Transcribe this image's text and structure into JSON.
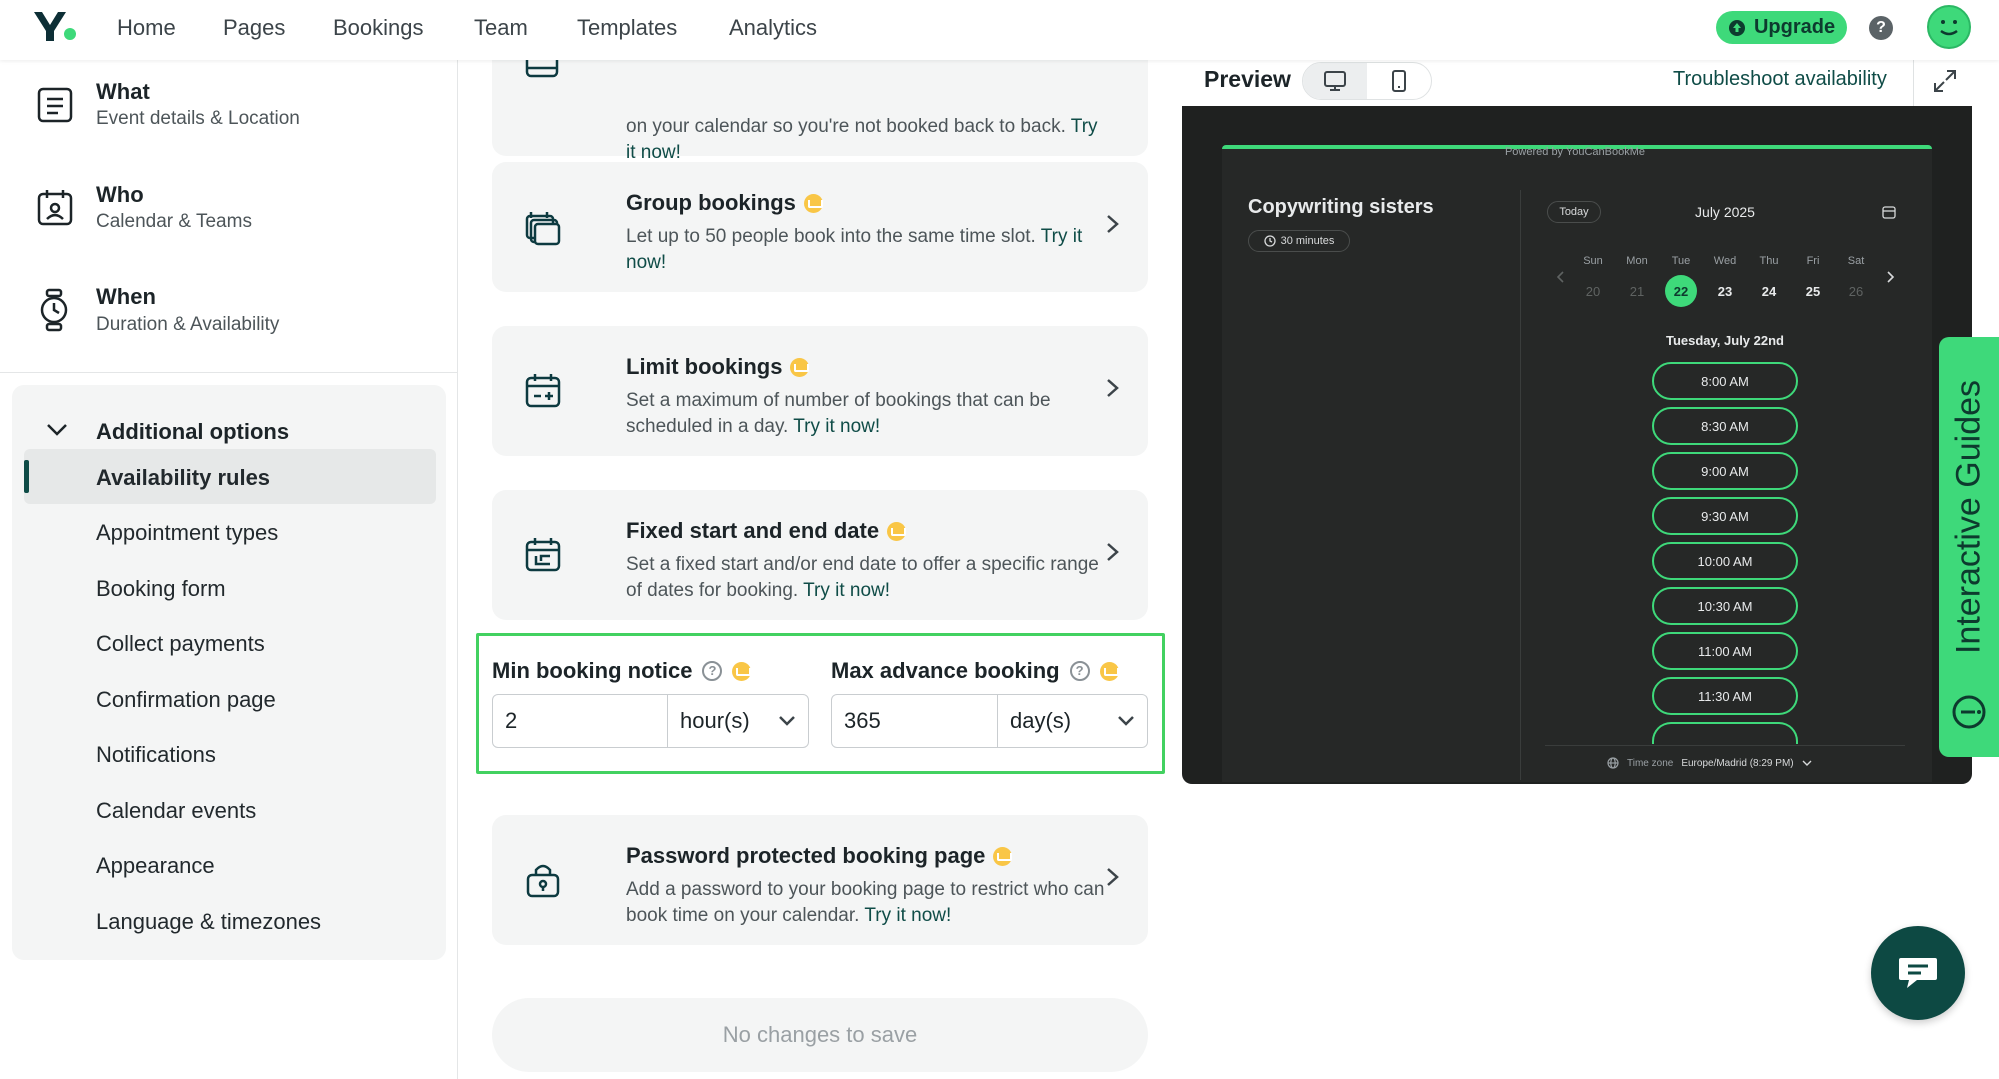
{
  "nav": {
    "links": [
      "Home",
      "Pages",
      "Bookings",
      "Team",
      "Templates",
      "Analytics"
    ],
    "upgrade_label": "Upgrade",
    "help_label": "?"
  },
  "sidebar": {
    "sections": [
      {
        "title": "What",
        "subtitle": "Event details & Location",
        "icon": "list-card-icon"
      },
      {
        "title": "Who",
        "subtitle": "Calendar & Teams",
        "icon": "calendar-person-icon"
      },
      {
        "title": "When",
        "subtitle": "Duration & Availability",
        "icon": "watch-icon"
      }
    ],
    "additional": {
      "title": "Additional options",
      "active_index": 0,
      "items": [
        "Availability rules",
        "Appointment types",
        "Booking form",
        "Collect payments",
        "Confirmation page",
        "Notifications",
        "Calendar events",
        "Appearance",
        "Language & timezones"
      ]
    }
  },
  "main": {
    "top_card": {
      "desc": "on your calendar so you're not booked back to back.",
      "link": "Try it now!"
    },
    "cards": [
      {
        "title": "Group bookings",
        "desc": "Let up to 50 people book into the same time slot.",
        "link": "Try it now!",
        "icon": "layers-icon"
      },
      {
        "title": "Limit bookings",
        "desc": "Set a maximum of number of bookings that can be scheduled in a day.",
        "link": "Try it now!",
        "icon": "calendar-plus-icon"
      },
      {
        "title": "Fixed start and end date",
        "desc": "Set a fixed start and/or end date to offer a specific range of dates for booking.",
        "link": "Try it now!",
        "icon": "calendar-range-icon"
      }
    ],
    "booking_fields": {
      "min": {
        "label": "Min booking notice",
        "value": "2",
        "unit": "hour(s)"
      },
      "max": {
        "label": "Max advance booking",
        "value": "365",
        "unit": "day(s)"
      }
    },
    "password_card": {
      "title": "Password protected booking page",
      "desc": "Add a password to your booking page to restrict who can book time on your calendar.",
      "link": "Try it now!",
      "icon": "lock-icon"
    },
    "save_label": "No changes to save"
  },
  "preview": {
    "title": "Preview",
    "troubleshoot": "Troubleshoot availability",
    "powered": "Powered by YouCanBookMe",
    "event_name": "Copywriting sisters",
    "duration": "30 minutes",
    "today": "Today",
    "month": "July 2025",
    "days": [
      {
        "name": "Sun",
        "num": "20",
        "state": "dim"
      },
      {
        "name": "Mon",
        "num": "21",
        "state": "dim"
      },
      {
        "name": "Tue",
        "num": "22",
        "state": "selected"
      },
      {
        "name": "Wed",
        "num": "23",
        "state": "normal"
      },
      {
        "name": "Thu",
        "num": "24",
        "state": "normal"
      },
      {
        "name": "Fri",
        "num": "25",
        "state": "normal"
      },
      {
        "name": "Sat",
        "num": "26",
        "state": "dim"
      }
    ],
    "selected_date": "Tuesday, July 22nd",
    "slots": [
      "8:00 AM",
      "8:30 AM",
      "9:00 AM",
      "9:30 AM",
      "10:00 AM",
      "10:30 AM",
      "11:00 AM",
      "11:30 AM"
    ],
    "timezone_label": "Time zone",
    "timezone_value": "Europe/Madrid (8:29 PM)"
  },
  "guides_label": "Interactive Guides",
  "colors": {
    "brand_green": "#3ed97a",
    "dark_teal": "#0f4c47",
    "highlight": "#42d160",
    "crown": "#f9c646"
  }
}
